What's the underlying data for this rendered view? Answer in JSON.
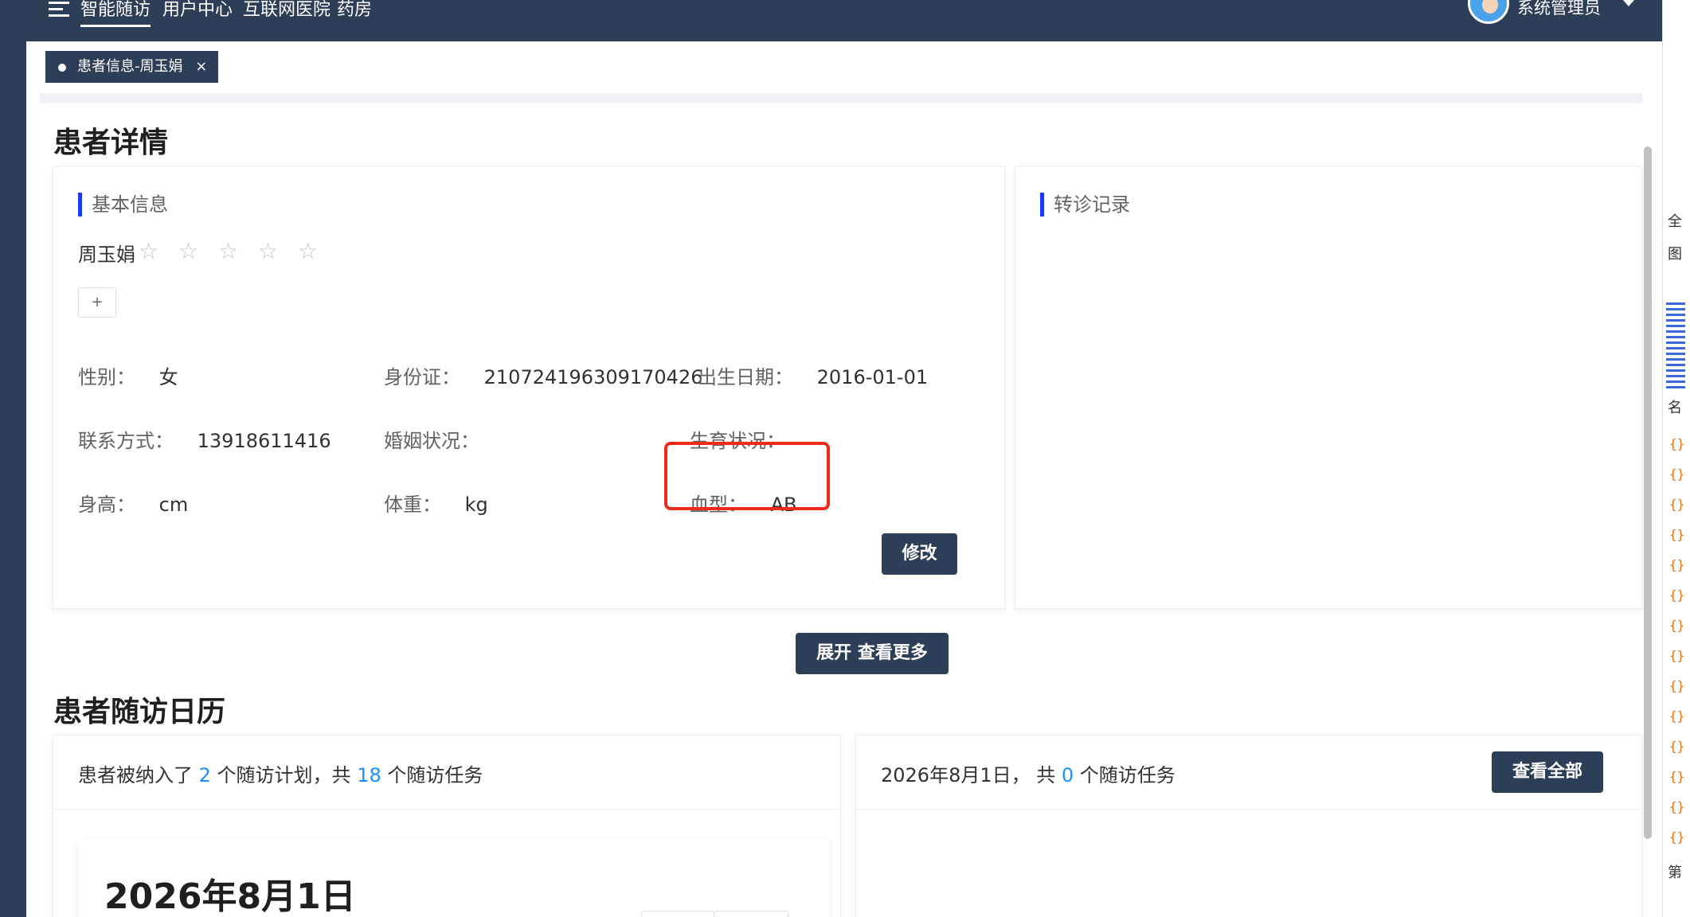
{
  "nav": {
    "items": [
      "智能随访",
      "用户中心",
      "互联网医院",
      "药房"
    ],
    "user_name": "系统管理员"
  },
  "tabs": [
    {
      "label": "患者信息-周玉娟",
      "close": "×"
    }
  ],
  "patient_detail": {
    "title": "患者详情",
    "basic_info": {
      "heading": "基本信息",
      "name": "周玉娟",
      "stars": "☆ ☆ ☆ ☆ ☆",
      "add_label": "+",
      "fields": {
        "gender": {
          "label": "性别：",
          "value": "女"
        },
        "id_card": {
          "label": "身份证：",
          "value": "210724196309170426"
        },
        "birth": {
          "label": "出生日期：",
          "value": "2016-01-01"
        },
        "contact": {
          "label": "联系方式：",
          "value": "13918611416"
        },
        "marriage": {
          "label": "婚姻状况：",
          "value": ""
        },
        "fertility": {
          "label": "生育状况：",
          "value": ""
        },
        "height": {
          "label": "身高：",
          "value": "cm"
        },
        "weight": {
          "label": "体重：",
          "value": "kg"
        },
        "blood_type": {
          "label": "血型：",
          "value": "AB"
        }
      },
      "edit_button": "修改"
    },
    "referral": {
      "heading": "转诊记录"
    },
    "expand_button": "展开 查看更多"
  },
  "calendar": {
    "title": "患者随访日历",
    "summary": {
      "prefix": "患者被纳入了 ",
      "plan_count": "2",
      "middle": " 个随访计划，共 ",
      "task_count": "18",
      "suffix": " 个随访任务"
    },
    "date_title": "2026年8月1日",
    "day_summary": {
      "prefix": "2026年8月1日， 共 ",
      "count": "0",
      "suffix": " 个随访任务"
    },
    "view_all_button": "查看全部"
  },
  "colors": {
    "nav_bg": "#2d3f57",
    "accent_blue": "#1890ff",
    "heading_bar": "#1a3cf5",
    "highlight": "#ee2b1a"
  },
  "right_strip": {
    "chars": [
      "全",
      "图",
      "名",
      "第"
    ]
  }
}
